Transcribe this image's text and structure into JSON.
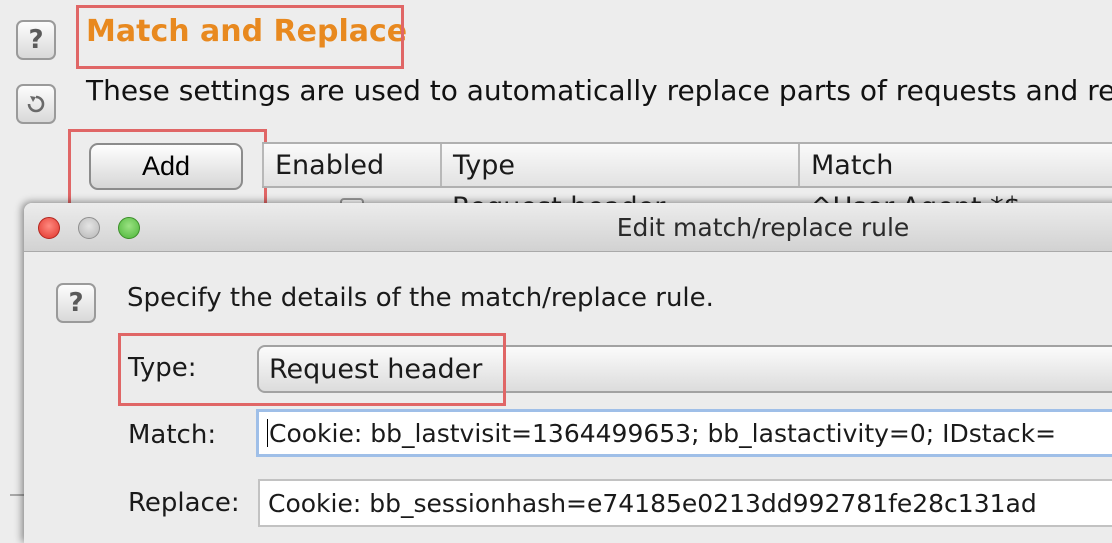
{
  "settings": {
    "title": "Match and Replace",
    "description": "These settings are used to automatically replace parts of requests and respo",
    "help_symbol": "?",
    "add_label": "Add",
    "columns": [
      "Enabled",
      "Type",
      "Match"
    ],
    "partial_row": {
      "type": "Request header",
      "match": "^User-Agent.*$"
    }
  },
  "dialog": {
    "title": "Edit match/replace rule",
    "help_symbol": "?",
    "instruction": "Specify the details of the match/replace rule.",
    "type_label": "Type:",
    "type_value": "Request header",
    "match_label": "Match:",
    "match_value": "Cookie: bb_lastvisit=1364499653; bb_lastactivity=0; IDstack=",
    "replace_label": "Replace:",
    "replace_value": "Cookie: bb_sessionhash=e74185e0213dd992781fe28c131ad"
  },
  "colors": {
    "title_accent": "#e8891f",
    "highlight": "#e06666",
    "focus_border": "#9fbfe8"
  },
  "icons": [
    "help-icon",
    "refresh-icon",
    "close-window-icon",
    "minimize-window-icon",
    "zoom-window-icon",
    "dropdown-arrow-icon"
  ]
}
